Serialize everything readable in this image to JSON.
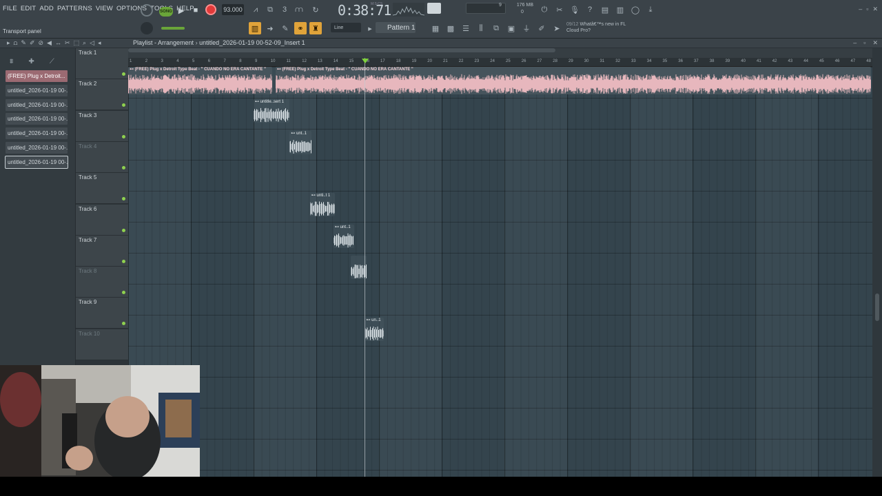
{
  "menu": [
    "FILE",
    "EDIT",
    "ADD",
    "PATTERNS",
    "VIEW",
    "OPTIONS",
    "TOOLS",
    "HELP"
  ],
  "transport": {
    "mode": "SONG",
    "tempo": "93.000",
    "time": "0:38:71",
    "time_unit": "M:S:CS",
    "cpu": "9",
    "memory": "176 MB",
    "memory2": "0"
  },
  "transport_panel_label": "Transport panel",
  "snap": "Line",
  "pattern": "Pattern 1",
  "news": {
    "date": "09/12",
    "text": "Whatâ€™s new in FL Cloud Pro?"
  },
  "playlist": {
    "title": "Playlist - Arrangement",
    "subtitle": "untitled_2026-01-19 00-52-09_Insert 1"
  },
  "picker": [
    {
      "label": "(FREE) Plug x Detroit...",
      "active": true
    },
    {
      "label": "untitled_2026-01-19 00-...",
      "active": false
    },
    {
      "label": "untitled_2026-01-19 00-...",
      "active": false
    },
    {
      "label": "untitled_2026-01-19 00-...",
      "active": false
    },
    {
      "label": "untitled_2026-01-19 00-...",
      "active": false
    },
    {
      "label": "untitled_2026-01-19 00-...",
      "active": false
    },
    {
      "label": "untitled_2026-01-19 00-...",
      "active": false,
      "selected": true
    }
  ],
  "tracks": [
    {
      "name": "Track 1",
      "dim": false
    },
    {
      "name": "Track 2",
      "dim": false
    },
    {
      "name": "Track 3",
      "dim": false
    },
    {
      "name": "Track 4",
      "dim": true
    },
    {
      "name": "Track 5",
      "dim": false
    },
    {
      "name": "Track 6",
      "dim": false
    },
    {
      "name": "Track 7",
      "dim": false
    },
    {
      "name": "Track 8",
      "dim": true
    },
    {
      "name": "Track 9",
      "dim": false
    },
    {
      "name": "Track 10",
      "dim": true
    }
  ],
  "ruler": [
    "1",
    "2",
    "3",
    "4",
    "5",
    "6",
    "7",
    "8",
    "9",
    "10",
    "11",
    "12",
    "13",
    "14",
    "15",
    "16",
    "17",
    "18",
    "19",
    "20",
    "21",
    "22",
    "23",
    "24",
    "25",
    "26",
    "27",
    "28",
    "29",
    "30",
    "31",
    "32",
    "33",
    "34",
    "35",
    "36",
    "37",
    "38",
    "39",
    "40",
    "41",
    "42",
    "43",
    "44",
    "45",
    "46",
    "47",
    "48"
  ],
  "clips": [
    {
      "track": 0,
      "start": 0,
      "len": 9.2,
      "label": "(FREE) Plug x Detroit Type Beat - \" CUANDO NO ERA CANTANTE \"",
      "kind": "big"
    },
    {
      "track": 0,
      "start": 9.4,
      "len": 38,
      "label": "(FREE) Plug x Detroit Type Beat - \" CUANDO NO ERA CANTANTE \"",
      "kind": "big"
    },
    {
      "track": 1,
      "start": 8.0,
      "len": 2.3,
      "label": "untitle..sert 1",
      "kind": "small"
    },
    {
      "track": 2,
      "start": 10.3,
      "len": 1.4,
      "label": "unt..1",
      "kind": "small"
    },
    {
      "track": 4,
      "start": 11.6,
      "len": 1.6,
      "label": "unti..t 1",
      "kind": "small"
    },
    {
      "track": 5,
      "start": 13.1,
      "len": 1.3,
      "label": "unt..1",
      "kind": "small"
    },
    {
      "track": 6,
      "start": 14.2,
      "len": 1.0,
      "label": "",
      "kind": "small"
    },
    {
      "track": 8,
      "start": 15.1,
      "len": 1.2,
      "label": "un..1",
      "kind": "small"
    }
  ],
  "playhead_bar": 15.0
}
